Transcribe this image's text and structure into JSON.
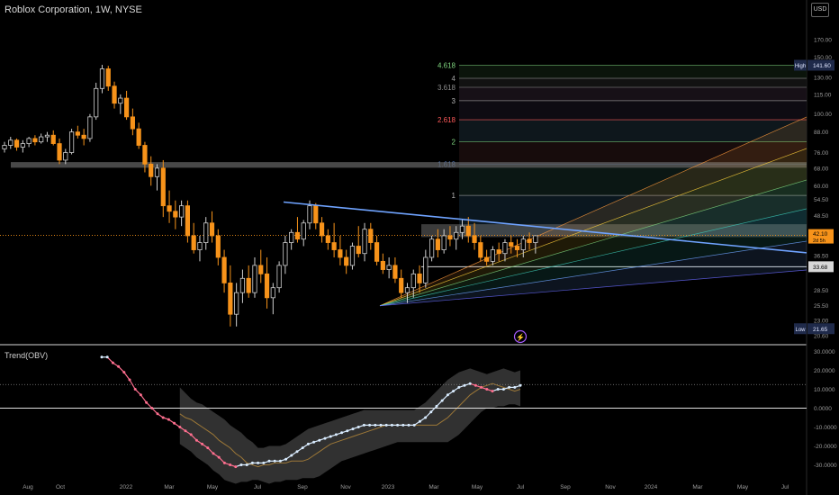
{
  "header": {
    "title": "Roblox Corporation, 1W, NYSE",
    "currency": "USD"
  },
  "colors": {
    "bg": "#000000",
    "up": "#cfcfcf",
    "down": "#f7931a",
    "trend": "#6fa3ff",
    "obv_up": "#d9ecff",
    "obv_down": "#ff6f8f"
  },
  "chart_data": [
    {
      "type": "candlestick",
      "title": "Roblox Corporation, 1W, NYSE",
      "y_scale": "log",
      "y_ticks": [
        "170.00",
        "150.00",
        "130.00",
        "115.00",
        "100.00",
        "88.00",
        "76.00",
        "68.00",
        "60.00",
        "54.50",
        "48.50",
        "42.10",
        "36.50",
        "33.68",
        "28.50",
        "25.50",
        "23.00",
        "20.60"
      ],
      "x_ticks": [
        "Aug",
        "Oct",
        "2022",
        "Mar",
        "May",
        "Jul",
        "Sep",
        "Nov",
        "2023",
        "Mar",
        "May",
        "Jul",
        "Sep",
        "Nov",
        "2024",
        "Mar",
        "May",
        "Jul"
      ],
      "ohlc": [
        [
          78,
          82,
          76,
          80
        ],
        [
          80,
          85,
          78,
          83
        ],
        [
          83,
          84,
          77,
          79
        ],
        [
          79,
          83,
          76,
          81
        ],
        [
          81,
          85,
          79,
          84
        ],
        [
          84,
          86,
          80,
          82
        ],
        [
          82,
          87,
          81,
          85
        ],
        [
          85,
          88,
          82,
          86
        ],
        [
          86,
          89,
          80,
          81
        ],
        [
          81,
          84,
          70,
          72
        ],
        [
          72,
          78,
          70,
          76
        ],
        [
          76,
          90,
          75,
          88
        ],
        [
          88,
          92,
          84,
          86
        ],
        [
          86,
          90,
          80,
          84
        ],
        [
          84,
          100,
          82,
          98
        ],
        [
          98,
          125,
          96,
          120
        ],
        [
          120,
          142,
          116,
          138
        ],
        [
          138,
          141,
          118,
          122
        ],
        [
          122,
          126,
          104,
          108
        ],
        [
          108,
          115,
          100,
          112
        ],
        [
          112,
          118,
          96,
          98
        ],
        [
          98,
          104,
          86,
          90
        ],
        [
          90,
          94,
          78,
          80
        ],
        [
          80,
          82,
          66,
          70
        ],
        [
          70,
          74,
          60,
          64
        ],
        [
          64,
          70,
          58,
          68
        ],
        [
          68,
          72,
          48,
          52
        ],
        [
          52,
          58,
          46,
          50
        ],
        [
          50,
          54,
          44,
          48
        ],
        [
          48,
          54,
          45,
          52
        ],
        [
          52,
          54,
          40,
          42
        ],
        [
          42,
          46,
          37,
          38
        ],
        [
          38,
          42,
          35,
          40
        ],
        [
          40,
          48,
          38,
          46
        ],
        [
          46,
          50,
          40,
          42
        ],
        [
          42,
          44,
          34,
          36
        ],
        [
          36,
          38,
          28,
          30
        ],
        [
          30,
          34,
          22,
          24
        ],
        [
          24,
          30,
          22,
          28
        ],
        [
          28,
          33,
          26,
          31
        ],
        [
          31,
          34,
          27,
          28
        ],
        [
          28,
          36,
          27,
          34
        ],
        [
          34,
          38,
          30,
          32
        ],
        [
          32,
          36,
          25,
          27
        ],
        [
          27,
          30,
          24,
          29
        ],
        [
          29,
          35,
          28,
          34
        ],
        [
          34,
          42,
          32,
          40
        ],
        [
          40,
          44,
          38,
          43
        ],
        [
          43,
          48,
          40,
          41
        ],
        [
          41,
          47,
          39,
          46
        ],
        [
          46,
          54,
          44,
          52
        ],
        [
          52,
          53,
          44,
          46
        ],
        [
          46,
          48,
          40,
          42
        ],
        [
          42,
          44,
          38,
          40
        ],
        [
          40,
          46,
          36,
          38
        ],
        [
          38,
          42,
          34,
          36
        ],
        [
          36,
          38,
          32,
          34
        ],
        [
          34,
          40,
          33,
          39
        ],
        [
          39,
          45,
          36,
          37
        ],
        [
          37,
          46,
          35,
          44
        ],
        [
          44,
          46,
          38,
          40
        ],
        [
          40,
          42,
          34,
          35
        ],
        [
          35,
          37,
          32,
          33
        ],
        [
          33,
          36,
          31,
          34
        ],
        [
          34,
          36,
          30,
          31
        ],
        [
          31,
          33,
          27,
          28
        ],
        [
          28,
          30,
          26,
          29
        ],
        [
          29,
          33,
          27,
          32
        ],
        [
          32,
          34,
          28,
          30
        ],
        [
          30,
          38,
          29,
          36
        ],
        [
          36,
          42,
          35,
          41
        ],
        [
          41,
          44,
          36,
          38
        ],
        [
          38,
          44,
          37,
          42
        ],
        [
          42,
          45,
          39,
          41
        ],
        [
          41,
          45,
          38,
          43
        ],
        [
          43,
          47,
          41,
          45
        ],
        [
          45,
          48,
          40,
          42
        ],
        [
          42,
          46,
          38,
          40
        ],
        [
          40,
          42,
          35,
          36
        ],
        [
          36,
          38,
          34,
          35
        ],
        [
          35,
          39,
          34,
          38
        ],
        [
          38,
          40,
          35,
          37
        ],
        [
          37,
          41,
          35,
          40
        ],
        [
          40,
          42,
          37,
          39
        ],
        [
          39,
          41,
          36,
          38
        ],
        [
          38,
          42,
          36,
          41
        ],
        [
          41,
          43,
          38,
          40
        ],
        [
          40,
          42,
          37,
          42
        ]
      ]
    },
    {
      "type": "line",
      "title": "Trend(OBV)",
      "y_ticks": [
        "30.0000",
        "20.0000",
        "10.0000",
        "0.0000",
        "-10.0000",
        "-20.0000",
        "-30.0000"
      ],
      "ylim": [
        -32,
        31
      ],
      "obv": [
        27,
        27,
        24,
        22,
        19,
        15,
        10,
        7,
        3,
        0,
        -3,
        -5,
        -6,
        -8,
        -10,
        -12,
        -14,
        -17,
        -19,
        -21,
        -24,
        -26,
        -29,
        -30,
        -31,
        -30,
        -30,
        -29,
        -29,
        -29,
        -28,
        -28,
        -28,
        -27,
        -25,
        -23,
        -21,
        -19,
        -18,
        -17,
        -16,
        -15,
        -14,
        -13,
        -12,
        -11,
        -10,
        -9,
        -9,
        -9,
        -9,
        -9,
        -9,
        -9,
        -9,
        -9,
        -9,
        -7,
        -5,
        -2,
        1,
        4,
        7,
        9,
        11,
        12,
        13,
        12,
        11,
        10,
        9,
        10,
        10,
        11,
        11,
        12
      ]
    }
  ],
  "overlays": {
    "fib_levels": [
      "4.618",
      "4",
      "3.618",
      "3",
      "2.618",
      "2",
      "1.618",
      "1"
    ],
    "price_labels": {
      "high": "High",
      "high_value": "141.60",
      "low": "Low",
      "low_value": "21.65",
      "current": "42.10",
      "countdown": "2d 5h",
      "support": "33.68"
    }
  }
}
